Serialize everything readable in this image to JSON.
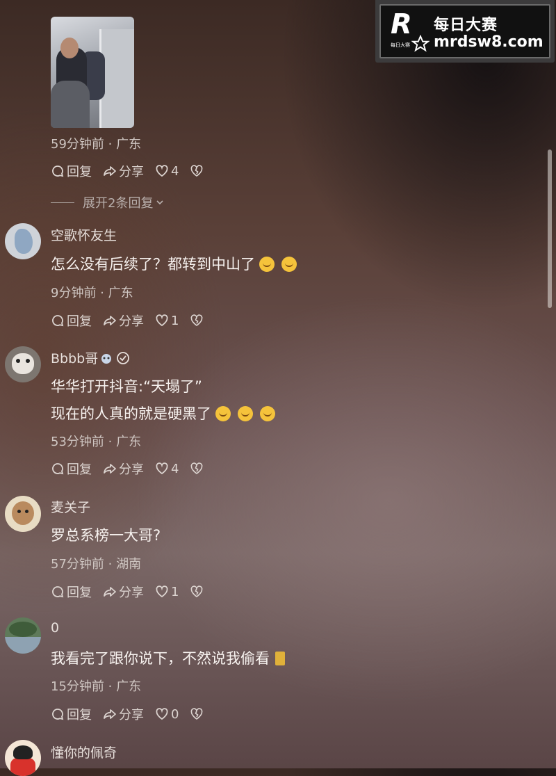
{
  "watermark": {
    "logo_letter": "R",
    "logo_sub": "每日大赛",
    "title": "每日大赛",
    "url": "mrdsw8.com"
  },
  "actions": {
    "reply": "回复",
    "share": "分享"
  },
  "expand_replies": "展开2条回复",
  "comments": [
    {
      "meta": "59分钟前 · 广东",
      "likes": "4"
    },
    {
      "username": "空歌怀友生",
      "text": "怎么没有后续了？都转到中山了",
      "meta": "9分钟前 · 广东",
      "likes": "1"
    },
    {
      "username": "Bbbb哥",
      "text_line1": "华华打开抖音:“天塌了”",
      "text_line2": "现在的人真的就是硬黑了",
      "meta": "53分钟前 · 广东",
      "likes": "4"
    },
    {
      "username": "麦关子",
      "text": "罗总系榜一大哥?",
      "meta": "57分钟前 · 湖南",
      "likes": "1"
    },
    {
      "username": "0",
      "text": "我看完了跟你说下，不然说我偷看",
      "meta": "15分钟前 · 广东",
      "likes": "0"
    },
    {
      "username": "懂你的佩奇"
    }
  ]
}
